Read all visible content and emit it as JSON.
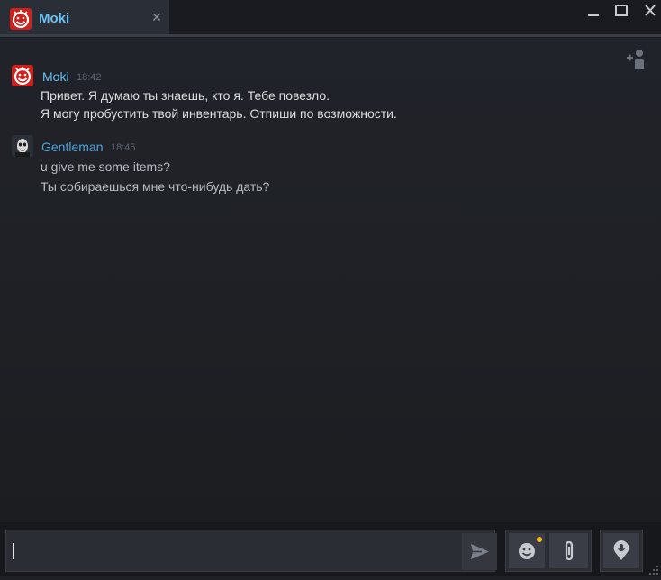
{
  "tab": {
    "name": "Moki",
    "close_glyph": "✕",
    "avatar_icon": "red-smiley-avatar-icon",
    "active": true
  },
  "window_controls": {
    "minimize_icon": "minimize-icon",
    "maximize_icon": "maximize-icon",
    "close_icon": "close-icon"
  },
  "header": {
    "add_friend_icon": "add-friend-icon"
  },
  "messages": [
    {
      "sender": "Moki",
      "time": "18:42",
      "name_color": "#67c1f5",
      "avatar_icon": "red-smiley-avatar-icon",
      "lines": [
        "Привет. Я думаю ты знаешь, кто я. Тебе повезло.",
        "Я могу пробустить твой инвентарь. Отпиши по возможности."
      ]
    },
    {
      "sender": "Gentleman",
      "time": "18:45",
      "name_color": "#4ca3d9",
      "avatar_icon": "skull-face-avatar-icon",
      "lines": [
        "u give me some items?",
        "Ты собираешься мне что-нибудь дать?"
      ]
    }
  ],
  "composer": {
    "value": "",
    "send_icon": "send-arrow-icon",
    "emoticon_icon": "smiley-icon",
    "emoticon_notification": true,
    "attach_icon": "paperclip-icon",
    "voice_icon": "microphone-pin-icon"
  },
  "colors": {
    "accent": "#67c1f5",
    "background": "#1e2025",
    "text": "#dcdedf",
    "notification": "#f5c518"
  }
}
